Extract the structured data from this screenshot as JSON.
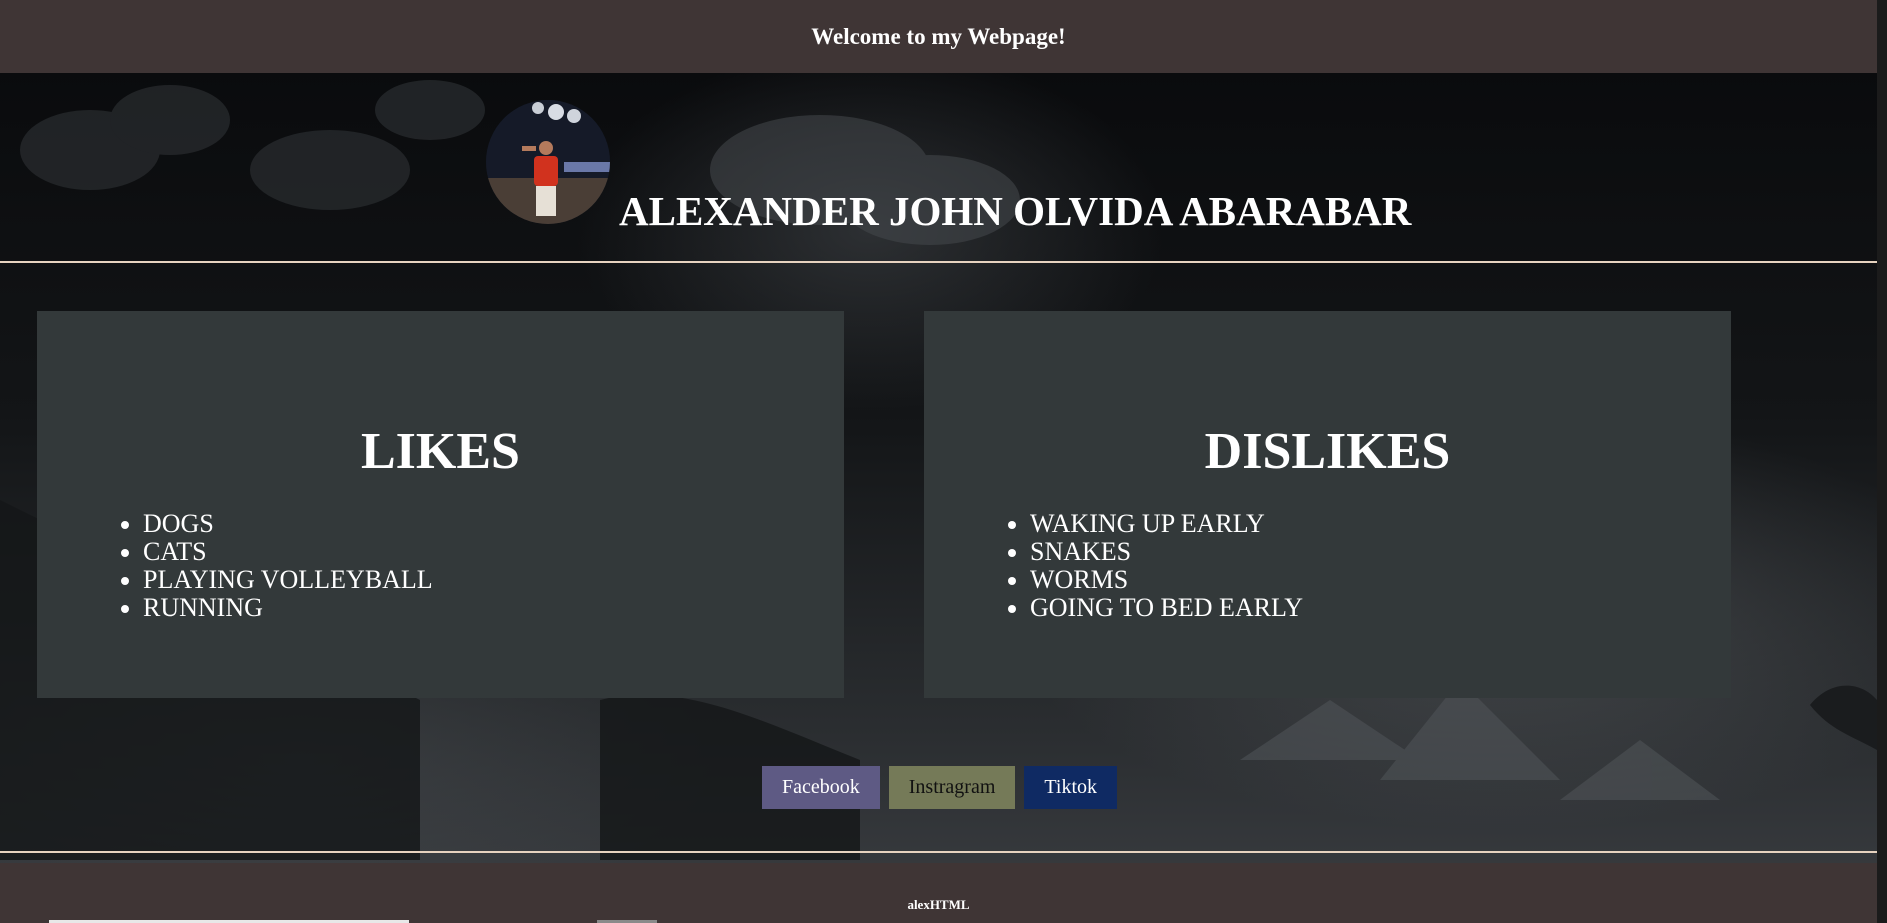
{
  "header": {
    "title": "Welcome to my Webpage!"
  },
  "profile": {
    "name": "ALEXANDER JOHN OLVIDA ABARABAR"
  },
  "likes": {
    "heading": "LIKES",
    "items": [
      "DOGS",
      "CATS",
      "PLAYING VOLLEYBALL",
      "RUNNING"
    ]
  },
  "dislikes": {
    "heading": "DISLIKES",
    "items": [
      "WAKING UP EARLY",
      "SNAKES",
      "WORMS",
      "GOING TO BED EARLY"
    ]
  },
  "socials": {
    "facebook": "Facebook",
    "instagram": "Instragram",
    "tiktok": "Tiktok"
  },
  "footer": {
    "text": "alexHTML"
  },
  "colors": {
    "header_bg": "#3f3535",
    "card_bg": "#33393a",
    "facebook_bg": "#5e5a84",
    "instagram_bg": "#757a58",
    "tiktok_bg": "#0f2a63",
    "rule": "#e7d3c0"
  }
}
